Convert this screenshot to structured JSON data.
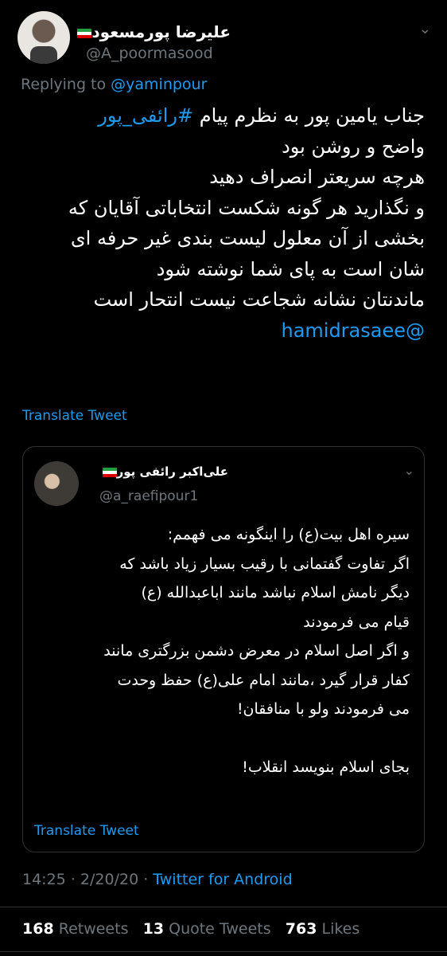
{
  "tweet": {
    "author_name": "علیرضا پورمسعود",
    "author_handle": "@A_poormasood",
    "replying_prefix": "Replying to ",
    "replying_handle": "@yaminpour",
    "body_lines": [
      "جناب یامین پور به نظرم پیام",
      "واضح و روشن بود",
      "هرچه سریعتر انصراف دهید",
      "و نگذارید هر گونه شکست انتخاباتی آقایان که",
      "بخشی از آن معلول لیست بندی غیر حرفه ای",
      "شان است به پای شما نوشته شود",
      "ماندنتان نشانه شجاعت نیست انتحار است"
    ],
    "hashtag": "#رائفی_پور",
    "mention": "@hamidrasaee",
    "translate_label": "Translate Tweet",
    "time": "14:25",
    "date": "2/20/20",
    "separator": "·",
    "source": "Twitter for Android"
  },
  "quoted_tweet": {
    "author_name": "علی‌اکبر رائفی پور",
    "author_handle": "@a_raefipour1",
    "body_lines": [
      "سیره اهل بیت(ع) را اینگونه می فهمم:",
      "اگر تفاوت گفتمانی با رقیب بسیار زیاد باشد که",
      "دیگر نامش اسلام نباشد مانند اباعبدالله (ع)",
      "قیام می فرمودند",
      "و اگر اصل اسلام در معرض دشمن بزرگتری مانند",
      "کفار قرار گیرد ،مانند امام علی(ع) حفظ وحدت",
      "می فرمودند ولو با منافقان!",
      "",
      "بجای اسلام بنویسد انقلاب!"
    ],
    "translate_label": "Translate Tweet"
  },
  "stats": {
    "retweets_count": "168",
    "retweets_label": "Retweets",
    "quotes_count": "13",
    "quotes_label": "Quote Tweets",
    "likes_count": "763",
    "likes_label": "Likes"
  },
  "icons": {
    "flag": "iran-flag-icon",
    "more": "chevron-down-icon"
  },
  "colors": {
    "background": "#000000",
    "link": "#1d9bf0",
    "secondary_text": "#6e767d",
    "primary_text": "#ffffff"
  }
}
